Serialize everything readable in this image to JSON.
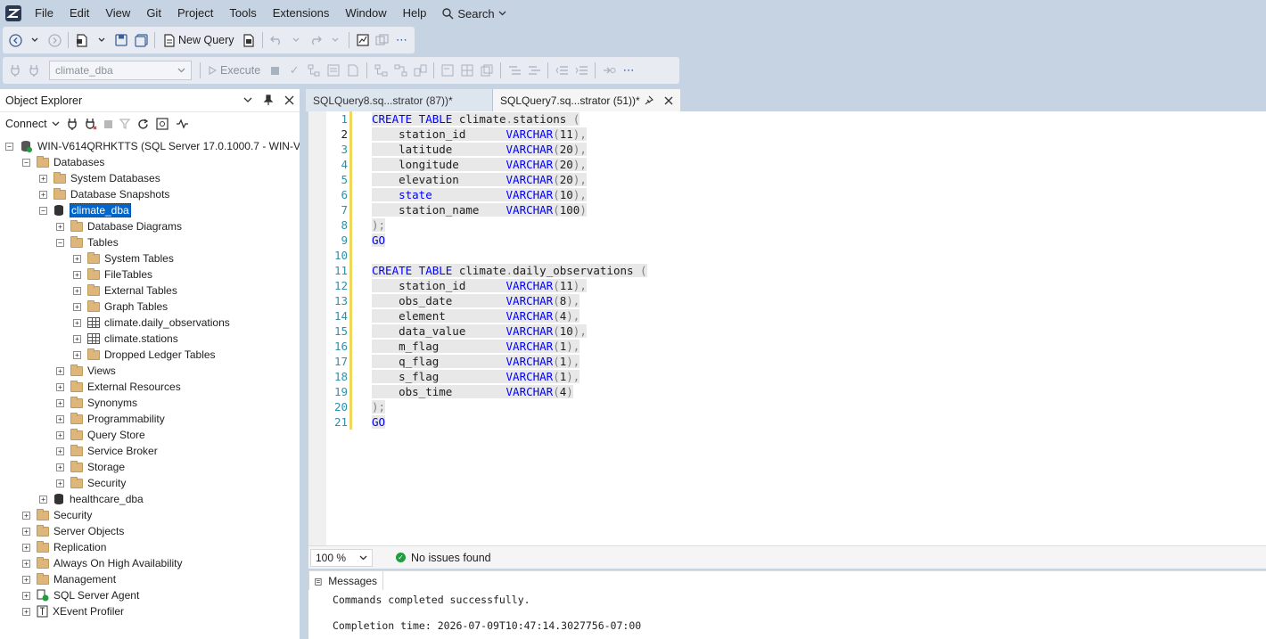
{
  "menu": {
    "items": [
      "File",
      "Edit",
      "View",
      "Git",
      "Project",
      "Tools",
      "Extensions",
      "Window",
      "Help"
    ],
    "search_label": "Search"
  },
  "toolbar": {
    "new_query_label": "New Query",
    "database_select": "climate_dba",
    "execute_label": "Execute"
  },
  "object_explorer": {
    "title": "Object Explorer",
    "connect_label": "Connect",
    "server": "WIN-V614QRHKTTS (SQL Server 17.0.1000.7 - WIN-V614Q",
    "nodes": {
      "databases": "Databases",
      "system_databases": "System Databases",
      "database_snapshots": "Database Snapshots",
      "climate_dba": "climate_dba",
      "database_diagrams": "Database Diagrams",
      "tables": "Tables",
      "system_tables": "System Tables",
      "file_tables": "FileTables",
      "external_tables": "External Tables",
      "graph_tables": "Graph Tables",
      "daily_observations": "climate.daily_observations",
      "stations": "climate.stations",
      "dropped_ledger_tables": "Dropped Ledger Tables",
      "views": "Views",
      "external_resources": "External Resources",
      "synonyms": "Synonyms",
      "programmability": "Programmability",
      "query_store": "Query Store",
      "service_broker": "Service Broker",
      "storage": "Storage",
      "db_security": "Security",
      "healthcare_dba": "healthcare_dba",
      "security": "Security",
      "server_objects": "Server Objects",
      "replication": "Replication",
      "always_on": "Always On High Availability",
      "management": "Management",
      "sql_server_agent": "SQL Server Agent",
      "xevent_profiler": "XEvent Profiler"
    }
  },
  "tabs": [
    {
      "label": "SQLQuery8.sq...strator (87))*"
    },
    {
      "label": "SQLQuery7.sq...strator (51))*"
    }
  ],
  "editor": {
    "line_numbers": [
      "1",
      "2",
      "3",
      "4",
      "5",
      "6",
      "7",
      "8",
      "9",
      "10",
      "11",
      "12",
      "13",
      "14",
      "15",
      "16",
      "17",
      "18",
      "19",
      "20",
      "21"
    ],
    "create_table": "CREATE TABLE",
    "schema": "climate",
    "table1": "stations",
    "table2": "daily_observations",
    "go": "GO",
    "varchar": "VARCHAR",
    "stations_cols": [
      {
        "name": "station_id",
        "size": "11",
        "end": ","
      },
      {
        "name": "latitude",
        "size": "20",
        "end": ","
      },
      {
        "name": "longitude",
        "size": "20",
        "end": ","
      },
      {
        "name": "elevation",
        "size": "20",
        "end": ","
      },
      {
        "name": "state",
        "size": "10",
        "end": ","
      },
      {
        "name": "station_name",
        "size": "100",
        "end": ""
      }
    ],
    "obs_cols": [
      {
        "name": "station_id",
        "size": "11",
        "end": ","
      },
      {
        "name": "obs_date",
        "size": "8",
        "end": ","
      },
      {
        "name": "element",
        "size": "4",
        "end": ","
      },
      {
        "name": "data_value",
        "size": "10",
        "end": ","
      },
      {
        "name": "m_flag",
        "size": "1",
        "end": ","
      },
      {
        "name": "q_flag",
        "size": "1",
        "end": ","
      },
      {
        "name": "s_flag",
        "size": "1",
        "end": ","
      },
      {
        "name": "obs_time",
        "size": "4",
        "end": ""
      }
    ]
  },
  "status": {
    "zoom": "100 %",
    "issues": "No issues found"
  },
  "messages": {
    "tab_label": "Messages",
    "line1": "Commands completed successfully.",
    "line2": "Completion time: 2026-07-09T10:47:14.3027756-07:00"
  },
  "colors": {
    "keyword": "#0000ff",
    "gray_punct": "#808080",
    "selection": "#0066cc",
    "chrome": "#c6d3e3",
    "folder": "#dcb67a"
  }
}
